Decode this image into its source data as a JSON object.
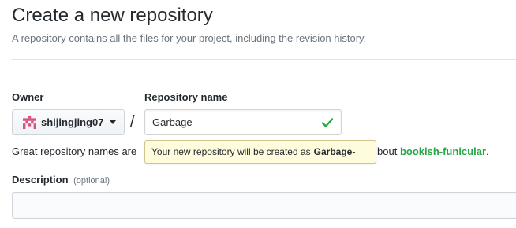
{
  "header": {
    "title": "Create a new repository",
    "subtitle": "A repository contains all the files for your project, including the revision history."
  },
  "owner": {
    "label": "Owner",
    "selected": "shijingjing07",
    "avatar_icon": "identicon-avatar",
    "caret_icon": "caret-down-icon"
  },
  "separator": "/",
  "repo": {
    "label": "Repository name",
    "value": "Garbage",
    "status_icon": "check-icon"
  },
  "hint": {
    "prefix": "Great repository names are",
    "tail_prefix": "bout",
    "suggestion": "bookish-funicular",
    "tail_suffix": "."
  },
  "tooltip": {
    "prefix": "Your new repository will be created as",
    "name": "Garbage-"
  },
  "description": {
    "label": "Description",
    "optional": "(optional)",
    "value": ""
  },
  "colors": {
    "accent_green": "#28a745",
    "avatar_pink": "#d9537d",
    "tooltip_bg": "#fffbdd"
  }
}
